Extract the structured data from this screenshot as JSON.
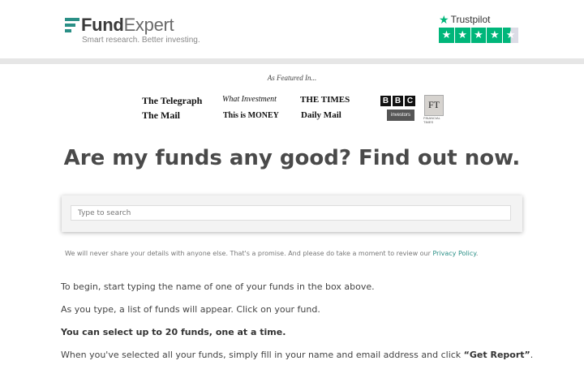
{
  "brand": {
    "name_bold": "Fund",
    "name_light": "Expert",
    "tagline": "Smart research. Better investing.",
    "accent": "#2a8f86"
  },
  "trustpilot": {
    "label": "Trustpilot",
    "rating_stars": 4.5,
    "star_color": "#00b67a",
    "icon": "star-icon"
  },
  "featured": {
    "heading": "As Featured In...",
    "publications": [
      "The Telegraph",
      "What Investment",
      "THE TIMES",
      "BBC",
      "FT",
      "The Mail",
      "This is MONEY",
      "Daily Mail",
      "investors chronicle"
    ]
  },
  "headline": "Are my funds any good? Find out now.",
  "search": {
    "placeholder": "Type to search",
    "value": ""
  },
  "privacy": {
    "text": "We will never share your details with anyone else. That's a promise. And please do take a moment to review our ",
    "link": "Privacy Policy",
    "end": "."
  },
  "instructions": {
    "line1": "To begin, start typing the name of one of your funds in the box above.",
    "line2": "As you type, a list of funds will appear. Click on your fund.",
    "line3": "You can select up to 20 funds, one at a time.",
    "line4_pre": "When you've selected all your funds, simply fill in your name and email address and click ",
    "line4_bold": "“Get Report”",
    "line4_end": "."
  }
}
